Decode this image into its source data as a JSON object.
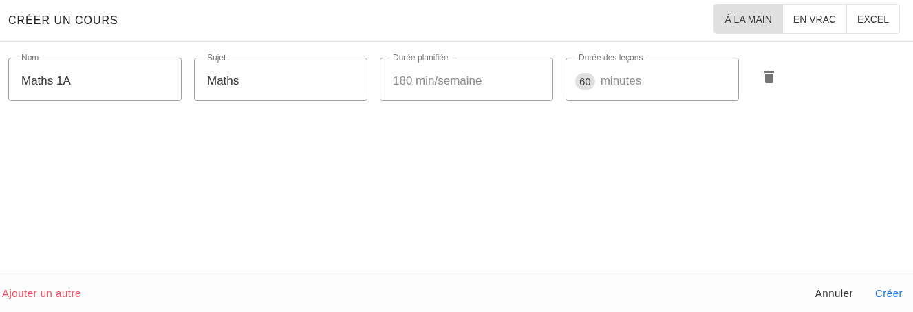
{
  "title": "CRÉER UN COURS",
  "modes": [
    {
      "label": "À LA MAIN",
      "selected": true
    },
    {
      "label": "EN VRAC",
      "selected": false
    },
    {
      "label": "EXCEL",
      "selected": false
    }
  ],
  "fields": [
    {
      "kind": "text",
      "label": "Nom",
      "value": "Maths 1A"
    },
    {
      "kind": "text",
      "label": "Sujet",
      "value": "Maths"
    },
    {
      "kind": "text",
      "label": "Durée planifiée",
      "placeholder": "180 min/semaine"
    },
    {
      "kind": "chip",
      "label": "Durée des leçons",
      "chip": "60",
      "placeholder": "minutes"
    }
  ],
  "footer": {
    "add_link": "Ajouter un autre",
    "cancel": "Annuler",
    "create": "Créer"
  }
}
